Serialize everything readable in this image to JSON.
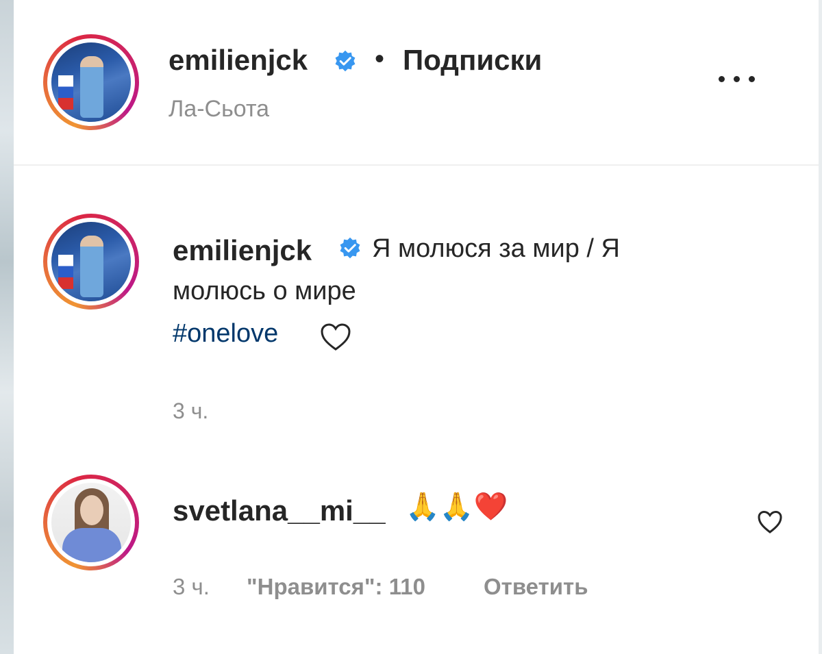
{
  "header": {
    "username": "emilienjck",
    "separator": "•",
    "follow_label": "Подписки",
    "location": "Ла-Сьота",
    "more_label": "..."
  },
  "caption": {
    "username": "emilienjck",
    "text_line1": "Я молюся за мир / Я",
    "text_line2": "молюсь о мире",
    "hashtag": "#onelove",
    "time": "3 ч."
  },
  "comment": {
    "username": "svetlana__mi__",
    "emoji": "🙏🙏❤️",
    "time": "3 ч.",
    "likes": "\"Нравится\": 110",
    "reply_label": "Ответить"
  },
  "colors": {
    "text": "#262626",
    "secondary": "#8e8e8e",
    "link": "#00376b",
    "verified": "#3897f0"
  },
  "icons": {
    "verified": "verified-badge-icon",
    "more": "more-options-icon",
    "heart": "heart-outline-icon"
  }
}
